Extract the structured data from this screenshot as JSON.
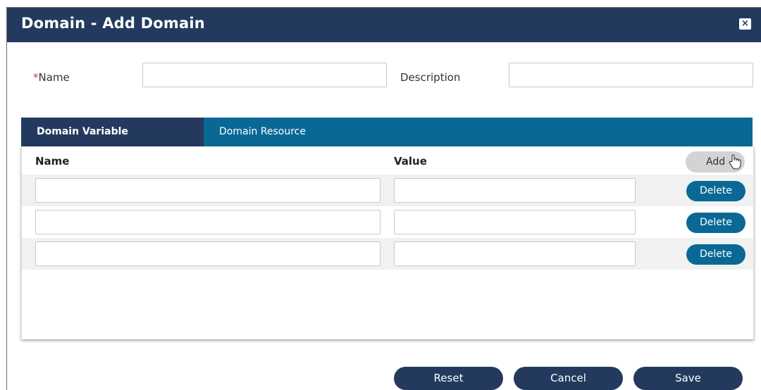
{
  "dialog": {
    "title": "Domain - Add Domain",
    "close_icon": "close-icon",
    "close_glyph": "×"
  },
  "form": {
    "name_required_marker": "*",
    "name_label": "Name",
    "name_value": "",
    "description_label": "Description",
    "description_value": ""
  },
  "tabs": [
    {
      "label": "Domain Variable",
      "active": true
    },
    {
      "label": "Domain Resource",
      "active": false
    }
  ],
  "variables_table": {
    "columns": [
      "Name",
      "Value"
    ],
    "add_label": "Add",
    "delete_label": "Delete",
    "rows": [
      {
        "name": "",
        "value": ""
      },
      {
        "name": "",
        "value": ""
      },
      {
        "name": "",
        "value": ""
      }
    ]
  },
  "footer": {
    "reset_label": "Reset",
    "cancel_label": "Cancel",
    "save_label": "Save"
  },
  "colors": {
    "header_navy": "#233a5e",
    "tab_blue": "#0a6895",
    "required_red": "#d9342b",
    "add_gray": "#d3d3d3"
  }
}
